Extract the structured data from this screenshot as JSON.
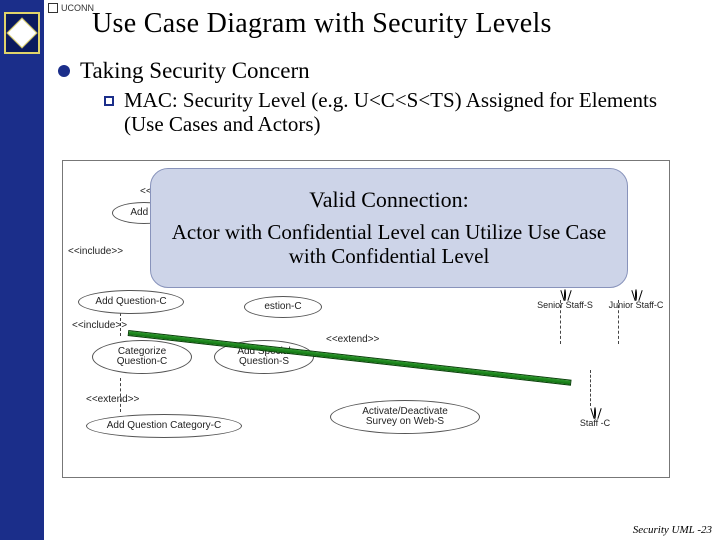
{
  "header": {
    "brand": "UCONN",
    "title": "Use Case Diagram with Security Levels"
  },
  "bullets": {
    "main": "Taking Security Concern",
    "sub": "MAC: Security Level (e.g. U<C<S<TS) Assigned for Elements (Use Cases and Actors)"
  },
  "callout": {
    "line1": "Valid Connection:",
    "line2": "Actor with Confidential Level can Utilize Use Case with Confidential Level"
  },
  "stereotypes": {
    "include1": "<<include>>",
    "include2": "<<include>>",
    "extend1": "<<extend>>",
    "extend2": "<<extend>>",
    "ext_label": "<<e"
  },
  "usecases": {
    "add_s": "Add S",
    "add_question_c": "Add Question-C",
    "question_c": "estion-C",
    "categorize": "Categorize\nQuestion-C",
    "add_special": "Add Special\nQuestion-S",
    "add_category": "Add Question Category-C",
    "activate": "Activate/Deactivate\nSurvey on Web-S"
  },
  "actors": {
    "senior": "Senior Staff-S",
    "junior": "Junior Staff-C",
    "staff": "Staff -C"
  },
  "footer": "Security UML -23"
}
